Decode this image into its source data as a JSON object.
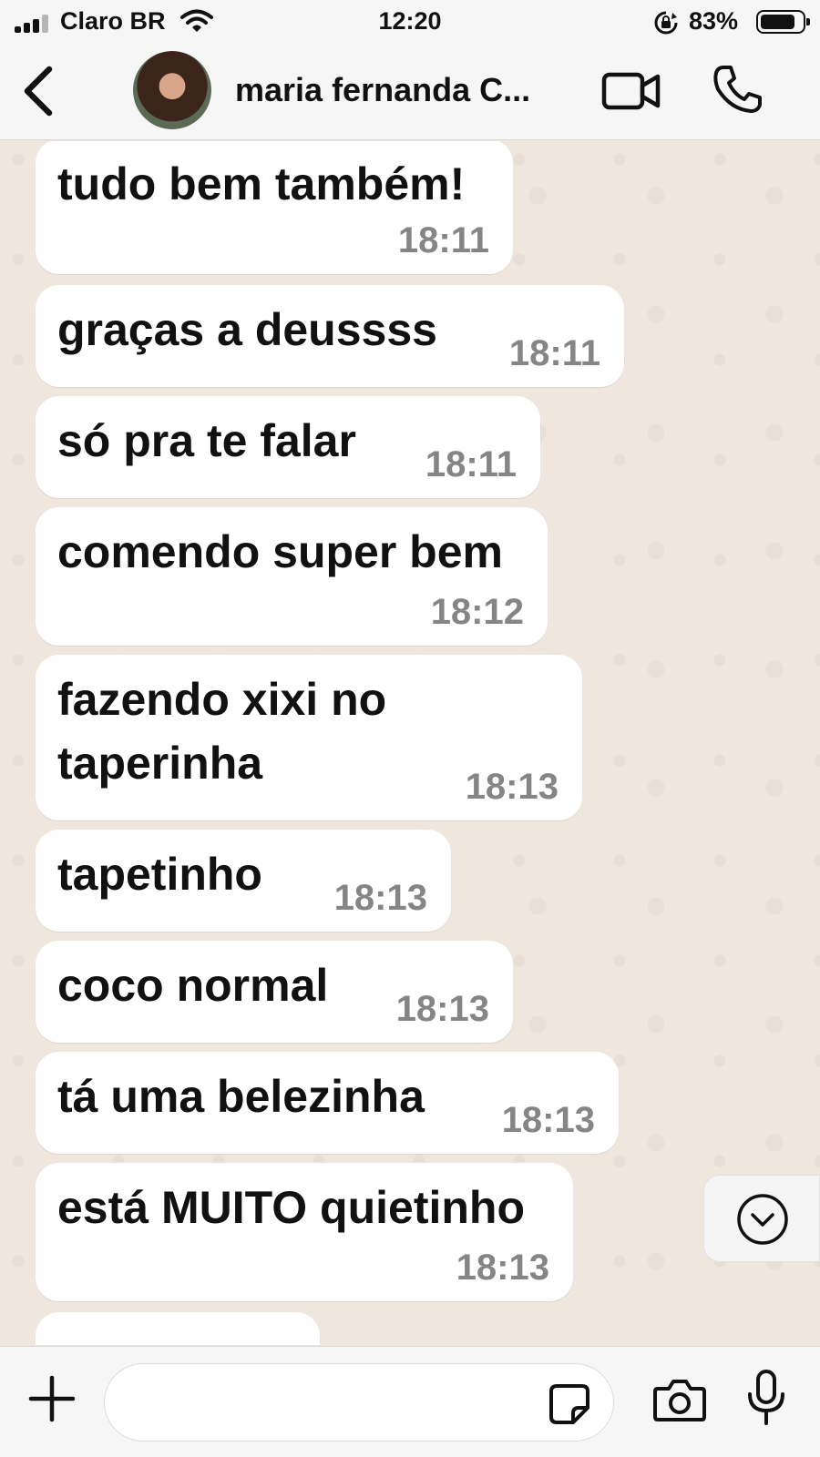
{
  "status_bar": {
    "carrier": "Claro BR",
    "time": "12:20",
    "battery_percent": "83%",
    "battery_level": 0.83,
    "icons": [
      "signal-icon",
      "wifi-icon",
      "rotation-lock-icon",
      "battery-icon"
    ]
  },
  "header": {
    "contact_name": "maria fernanda C...",
    "icons": [
      "back-chevron-icon",
      "video-call-icon",
      "phone-icon"
    ]
  },
  "messages": [
    {
      "text": "tudo bem também!",
      "time": "18:11"
    },
    {
      "text": "graças a deussss",
      "time": "18:11"
    },
    {
      "text": "só pra te falar",
      "time": "18:11"
    },
    {
      "text": "comendo super bem",
      "time": "18:12"
    },
    {
      "text": "fazendo xixi no taperinha",
      "time": "18:13"
    },
    {
      "text": "tapetinho",
      "time": "18:13"
    },
    {
      "text": "coco normal",
      "time": "18:13"
    },
    {
      "text": "tá uma belezinha",
      "time": "18:13"
    },
    {
      "text": "está MUITO quietinho",
      "time": "18:13"
    },
    {
      "text": "",
      "time": ""
    }
  ],
  "input_bar": {
    "placeholder": "",
    "icons": [
      "plus-icon",
      "sticker-icon",
      "camera-icon",
      "microphone-icon"
    ]
  },
  "colors": {
    "chat_background": "#efe7dd",
    "bubble": "#ffffff",
    "timestamp": "#858585",
    "bar_background": "#f6f6f6"
  }
}
